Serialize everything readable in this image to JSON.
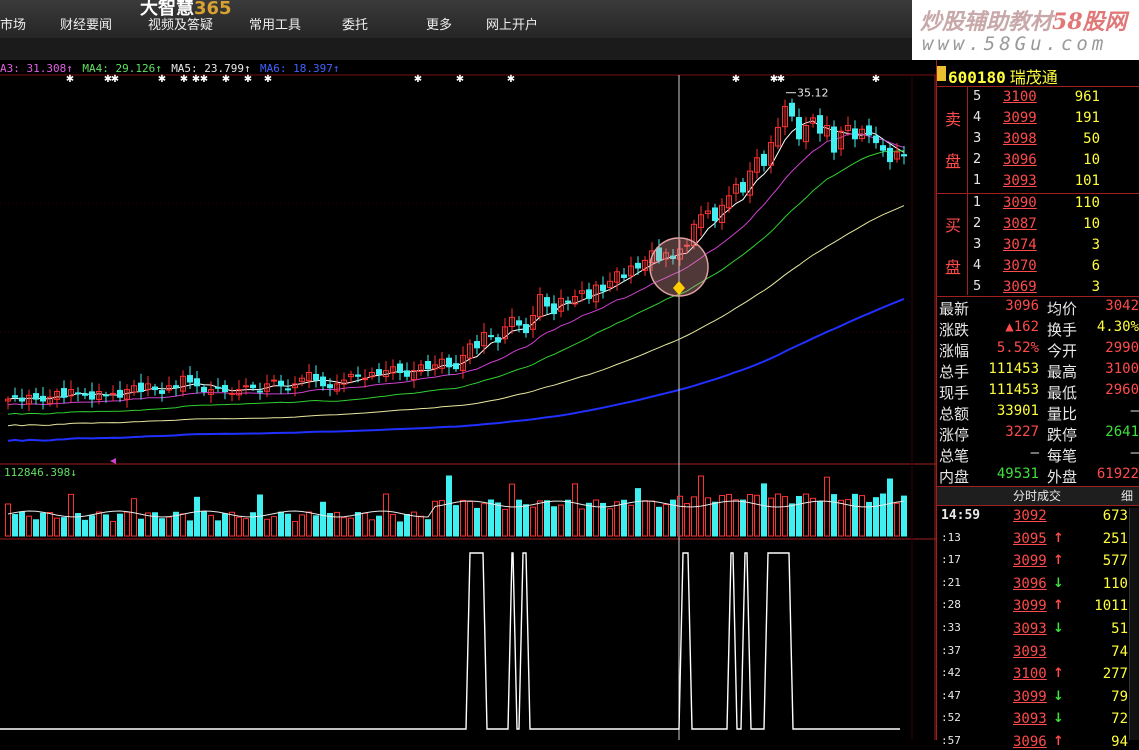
{
  "app": {
    "brand_text": "大智慧",
    "brand_num": "365",
    "nav": [
      "市场",
      "财经要闻",
      "视频及答疑",
      "常用工具",
      "委托",
      "更多",
      "网上开户"
    ]
  },
  "watermark": {
    "line1_a": "炒股辅助教材",
    "line1_b": "58股网",
    "line2": "www.58Gu.com"
  },
  "ma_labels": [
    {
      "text": "A3: 31.308↑",
      "color": "#e060e0"
    },
    {
      "text": "MA4: 29.126↑",
      "color": "#60e060"
    },
    {
      "text": "MA5: 23.799↑",
      "color": "#e8e8e8"
    },
    {
      "text": "MA6: 18.397↑",
      "color": "#4060ff"
    }
  ],
  "chart": {
    "high_label": "35.12",
    "volume_label": "112846.398↓",
    "colors": {
      "up": "#ff3030",
      "down": "#40f0f0",
      "ma_white": "#ffffff",
      "ma_magenta": "#d040d0",
      "ma_green": "#30d030",
      "ma_yellow": "#e8e8a0",
      "ma_blue": "#2030ff"
    }
  },
  "chart_data": {
    "type": "candlestick",
    "close": [
      19.1,
      19.2,
      19.0,
      19.3,
      19.1,
      19.0,
      19.2,
      19.5,
      19.2,
      19.6,
      19.4,
      19.3,
      19.1,
      19.5,
      19.3,
      19.4,
      19.2,
      19.6,
      19.8,
      19.5,
      19.9,
      19.6,
      19.4,
      19.8,
      19.7,
      20.3,
      20.0,
      19.8,
      19.5,
      19.6,
      19.7,
      19.5,
      19.4,
      19.6,
      19.8,
      19.7,
      19.5,
      19.9,
      20.1,
      19.8,
      19.6,
      19.9,
      20.2,
      20.5,
      20.1,
      19.8,
      19.7,
      19.9,
      20.1,
      20.4,
      20.3,
      20.2,
      20.5,
      20.4,
      20.6,
      20.8,
      20.5,
      20.3,
      20.6,
      20.9,
      20.7,
      20.9,
      21.2,
      20.8,
      20.7,
      21.4,
      22.0,
      21.8,
      22.6,
      22.4,
      22.1,
      22.9,
      23.4,
      23.0,
      22.6,
      23.5,
      24.6,
      24.0,
      23.6,
      24.4,
      24.2,
      24.5,
      24.8,
      24.4,
      25.1,
      24.8,
      25.3,
      25.8,
      25.5,
      26.1,
      26.0,
      26.4,
      26.9,
      26.4,
      26.8,
      26.5,
      27.0,
      27.2,
      28.3,
      28.8,
      29.0,
      28.5,
      29.3,
      29.8,
      30.4,
      30.0,
      31.1,
      31.8,
      31.4,
      32.6,
      33.4,
      34.5,
      34.0,
      32.8,
      33.5,
      33.9,
      33.1,
      33.5,
      32.1,
      33.2,
      33.5,
      32.8,
      33.3,
      33.0,
      32.6,
      32.2,
      31.6,
      32.1,
      31.9
    ],
    "ma_latest": {
      "MA3": 31.308,
      "MA4": 29.126,
      "MA5": 23.799,
      "MA6": 18.397
    },
    "high_marker": 35.12,
    "volume_ma": 112846.398
  },
  "quote": {
    "code": "600180",
    "name": "瑞茂通",
    "sell_label": [
      "卖",
      "盘"
    ],
    "buy_label": [
      "买",
      "盘"
    ],
    "asks": [
      {
        "lvl": "5",
        "price": "3100",
        "vol": "961"
      },
      {
        "lvl": "4",
        "price": "3099",
        "vol": "191"
      },
      {
        "lvl": "3",
        "price": "3098",
        "vol": "50"
      },
      {
        "lvl": "2",
        "price": "3096",
        "vol": "10"
      },
      {
        "lvl": "1",
        "price": "3093",
        "vol": "101"
      }
    ],
    "bids": [
      {
        "lvl": "1",
        "price": "3090",
        "vol": "110"
      },
      {
        "lvl": "2",
        "price": "3087",
        "vol": "10"
      },
      {
        "lvl": "3",
        "price": "3074",
        "vol": "3"
      },
      {
        "lvl": "4",
        "price": "3070",
        "vol": "6"
      },
      {
        "lvl": "5",
        "price": "3069",
        "vol": "3"
      }
    ],
    "stats": [
      {
        "l": "最新",
        "v": "3096",
        "vc": "red",
        "l2": "均价",
        "v2": "3042",
        "vc2": "red"
      },
      {
        "l": "涨跌",
        "v": "▲162",
        "vc": "red",
        "l2": "换手",
        "v2": "4.30%",
        "vc2": "yellow"
      },
      {
        "l": "涨幅",
        "v": "5.52%",
        "vc": "red",
        "l2": "今开",
        "v2": "2990",
        "vc2": "red"
      },
      {
        "l": "总手",
        "v": "111453",
        "vc": "yellow",
        "l2": "最高",
        "v2": "3100",
        "vc2": "red"
      },
      {
        "l": "现手",
        "v": "111453",
        "vc": "yellow",
        "l2": "最低",
        "v2": "2960",
        "vc2": "red"
      },
      {
        "l": "总额",
        "v": "33901",
        "vc": "yellow",
        "l2": "量比",
        "v2": "—",
        "vc2": "white"
      },
      {
        "l": "涨停",
        "v": "3227",
        "vc": "red",
        "l2": "跌停",
        "v2": "2641",
        "vc2": "green"
      },
      {
        "l": "总笔",
        "v": "—",
        "vc": "white",
        "l2": "每笔",
        "v2": "—",
        "vc2": "white"
      },
      {
        "l": "内盘",
        "v": "49531",
        "vc": "green",
        "l2": "外盘",
        "v2": "61922",
        "vc2": "red"
      }
    ],
    "ticks_title": "分时成交",
    "ticks_side": "细",
    "ticks": [
      {
        "t": "14:59",
        "p": "3092",
        "a": "",
        "v": "673"
      },
      {
        "t": ":13",
        "p": "3095",
        "a": "↑",
        "v": "251"
      },
      {
        "t": ":17",
        "p": "3099",
        "a": "↑",
        "v": "577"
      },
      {
        "t": ":21",
        "p": "3096",
        "a": "↓",
        "v": "110"
      },
      {
        "t": ":28",
        "p": "3099",
        "a": "↑",
        "v": "1011"
      },
      {
        "t": ":33",
        "p": "3093",
        "a": "↓",
        "v": "51"
      },
      {
        "t": ":37",
        "p": "3093",
        "a": "",
        "v": "74"
      },
      {
        "t": ":42",
        "p": "3100",
        "a": "↑",
        "v": "277"
      },
      {
        "t": ":47",
        "p": "3099",
        "a": "↓",
        "v": "79"
      },
      {
        "t": ":52",
        "p": "3093",
        "a": "↓",
        "v": "72"
      },
      {
        "t": ":57",
        "p": "3096",
        "a": "↑",
        "v": "94"
      }
    ]
  }
}
